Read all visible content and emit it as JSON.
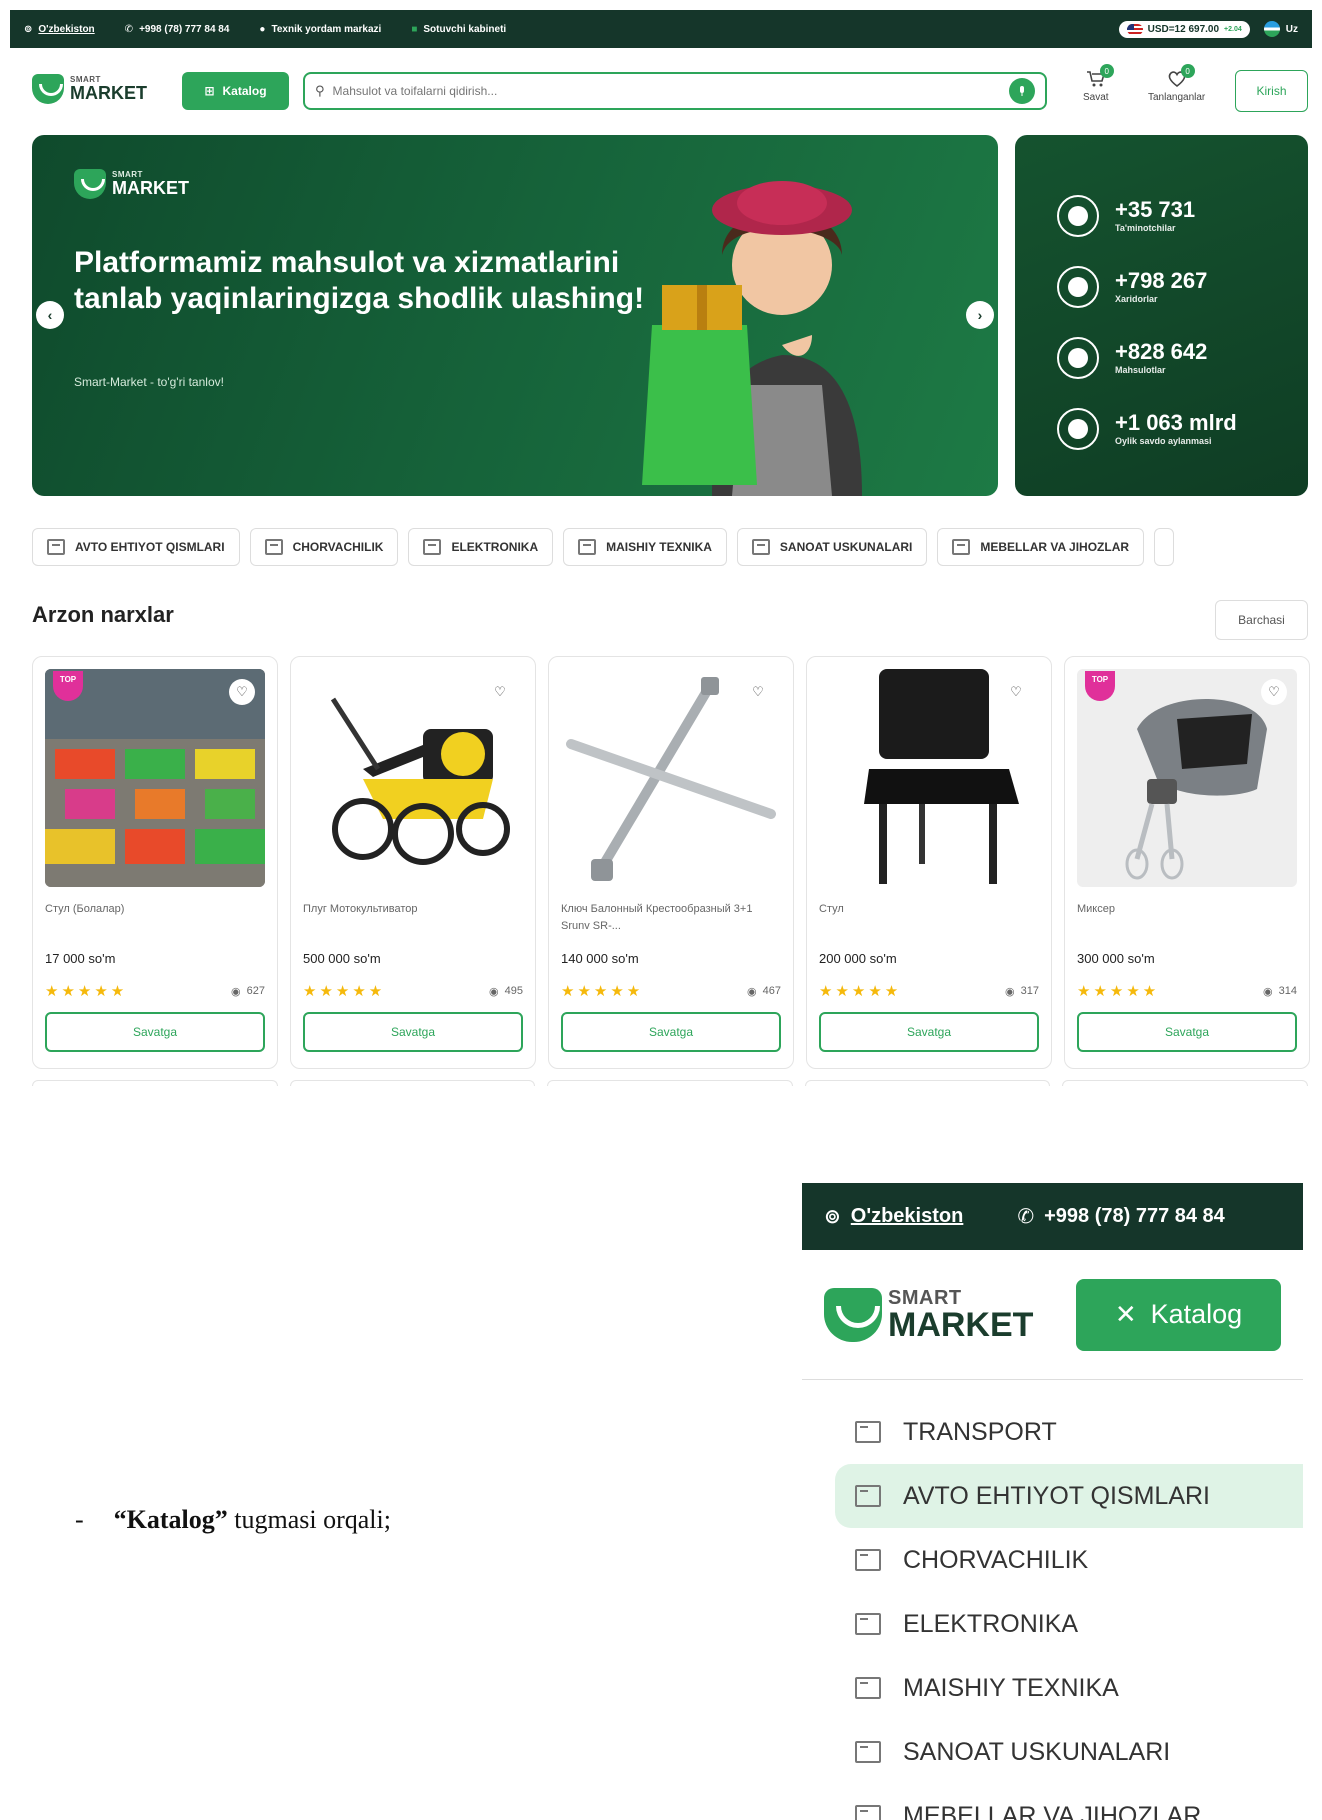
{
  "topbar": {
    "location": "O'zbekiston",
    "phone": "+998 (78) 777 84 84",
    "support": "Texnik yordam markazi",
    "seller": "Sotuvchi kabineti",
    "currency": "USD=12 697.00",
    "currency_change": "+2.04",
    "language": "Uz"
  },
  "header": {
    "logo_small": "SMART",
    "logo_big": "MARKET",
    "catalog_label": "Katalog",
    "search_placeholder": "Mahsulot va toifalarni qidirish...",
    "cart_label": "Savat",
    "cart_count": "0",
    "favorites_label": "Tanlanganlar",
    "favorites_count": "0",
    "login_label": "Kirish"
  },
  "banner": {
    "logo_small": "SMART",
    "logo_big": "MARKET",
    "headline": "Platformamiz mahsulot va xizmatlarini tanlab yaqinlaringizga shodlik ulashing!",
    "subline": "Smart-Market - to'g'ri tanlov!"
  },
  "stats": [
    {
      "value": "+35 731",
      "label": "Ta'minotchilar"
    },
    {
      "value": "+798 267",
      "label": "Xaridorlar"
    },
    {
      "value": "+828 642",
      "label": "Mahsulotlar"
    },
    {
      "value": "+1 063 mlrd",
      "label": "Oylik savdo aylanmasi"
    }
  ],
  "categories": [
    "AVTO EHTIYOT QISMLARI",
    "CHORVACHILIK",
    "ELEKTRONIKA",
    "MAISHIY TEXNIKA",
    "SANOAT USKUNALARI",
    "MEBELLAR VA JIHOZLAR"
  ],
  "section": {
    "title": "Arzon narxlar",
    "see_all": "Barchasi"
  },
  "products": [
    {
      "name": "Стул (Болалар)",
      "price": "17 000 so'm",
      "views": "627",
      "cart": "Savatga",
      "top": true,
      "top_label": "TOP"
    },
    {
      "name": "Плуг Мотокультиватор",
      "price": "500 000 so'm",
      "views": "495",
      "cart": "Savatga",
      "top": false
    },
    {
      "name": "Ключ Балонный Крестообразный 3+1 Srunv SR-...",
      "price": "140 000 so'm",
      "views": "467",
      "cart": "Savatga",
      "top": false
    },
    {
      "name": "Стул",
      "price": "200 000 so'm",
      "views": "317",
      "cart": "Savatga",
      "top": false
    },
    {
      "name": "Миксер",
      "price": "300 000 so'm",
      "views": "314",
      "cart": "Savatga",
      "top": true,
      "top_label": "TOP"
    }
  ],
  "doc": {
    "dash": "-",
    "bold": "“Katalog”",
    "rest": " tugmasi orqali;"
  },
  "mobile": {
    "location": "O'zbekiston",
    "phone": "+998 (78) 777 84 84",
    "logo_small": "SMART",
    "logo_big": "MARKET",
    "catalog_label": "Katalog",
    "menu": [
      "TRANSPORT",
      "AVTO EHTIYOT QISMLARI",
      "CHORVACHILIK",
      "ELEKTRONIKA",
      "MAISHIY TEXNIKA",
      "SANOAT USKUNALARI",
      "MEBELLAR VA JIHOZLAR"
    ],
    "active_index": 1
  },
  "colors": {
    "brand": "#2da55a",
    "dark": "#15362a",
    "accent_top": "#e0309a",
    "star": "#f5b90c"
  }
}
